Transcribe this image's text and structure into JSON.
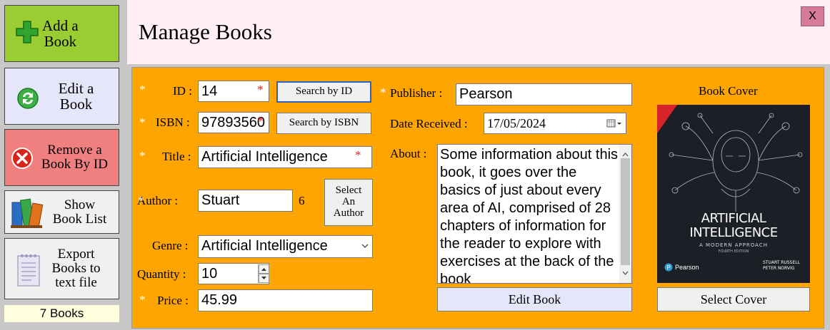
{
  "sidebar": {
    "add_book": "Add a\nBook",
    "edit_book": "Edit a\nBook",
    "remove_book": "Remove a\nBook By ID",
    "show_list": "Show\nBook List",
    "export": "Export\nBooks to\ntext file",
    "count": "7 Books"
  },
  "window": {
    "title": "Manage Books",
    "close": "X"
  },
  "form": {
    "star": "*",
    "required_mark": "*",
    "id_label": "ID :",
    "id_value": "14",
    "search_id": "Search by ID",
    "isbn_label": "ISBN :",
    "isbn_value": "97893560",
    "search_isbn": "Search by ISBN",
    "title_label": "Title :",
    "title_value": "Artificial Intelligence",
    "author_label": "Author :",
    "author_value": "Stuart",
    "author_count": "6",
    "select_author": "Select\nAn\nAuthor",
    "genre_label": "Genre :",
    "genre_value": "Artificial Intelligence",
    "quantity_label": "Quantity :",
    "quantity_value": "10",
    "price_label": "Price :",
    "price_value": "45.99",
    "publisher_label": "Publisher :",
    "publisher_value": "Pearson",
    "date_label": "Date Received :",
    "date_value": "17/05/2024",
    "about_label": "About :",
    "about_value": "Some information about this book, it goes over the basics of just about every area of AI, comprised of 28 chapters of information for the reader to explore with exercises at the back of the book",
    "edit_button": "Edit Book",
    "cover_label": "Book Cover",
    "select_cover": "Select Cover"
  },
  "cover": {
    "title_line1": "ARTIFICIAL",
    "title_line2": "INTELLIGENCE",
    "subtitle": "A MODERN APPROACH",
    "edition": "FOURTH EDITION",
    "author1": "STUART RUSSELL",
    "author2": "PETER NORVIG",
    "publisher": "Pearson"
  },
  "colors": {
    "panel": "#ffa500",
    "add_btn": "#9acd32",
    "edit_btn": "#e6e6fa",
    "remove_btn": "#f08080",
    "title_bg": "#ffeef2"
  }
}
